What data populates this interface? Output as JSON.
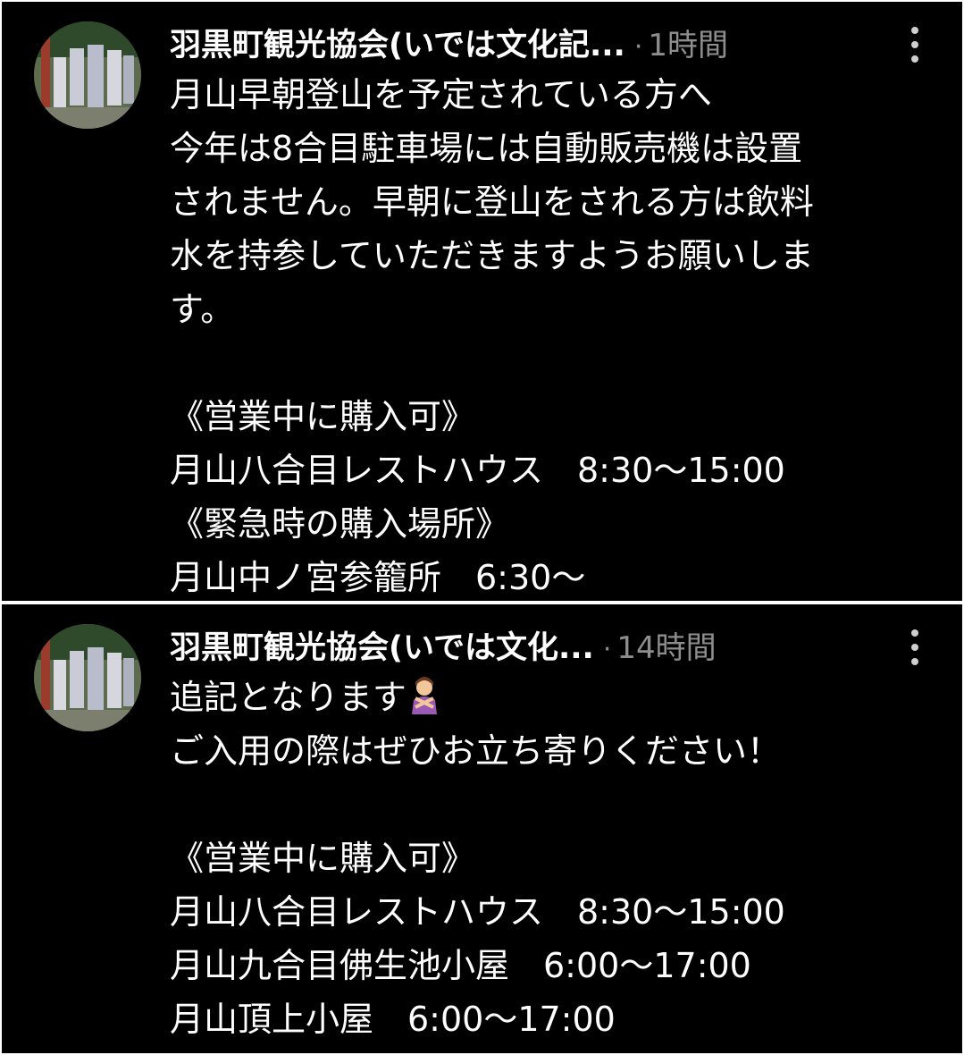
{
  "posts": [
    {
      "author": "羽黒町観光協会(いでは文化記...",
      "time": "1時間",
      "lines": [
        "月山早朝登山を予定されている方へ",
        "今年は8合目駐車場には自動販売機は設置",
        "されません。早朝に登山をされる方は飲料",
        "水を持参していただきますようお願いしま",
        "す。",
        "",
        "《営業中に購入可》",
        "月山八合目レストハウス　8:30〜15:00",
        "《緊急時の購入場所》",
        "月山中ノ宮参籠所　6:30〜"
      ]
    },
    {
      "author": "羽黒町観光協会(いでは文化...",
      "time": "14時間",
      "first_line": "追記となります",
      "emoji": "person-gesturing-no-emoji",
      "lines": [
        "ご入用の際はぜひお立ち寄りください！",
        "",
        "《営業中に購入可》",
        "月山八合目レストハウス　8:30〜15:00",
        "月山九合目佛生池小屋　6:00〜17:00",
        "月山頂上小屋　6:00〜17:00"
      ]
    }
  ],
  "icons": {
    "avatar": "avatar-image",
    "more": "more-vertical-icon"
  },
  "colors": {
    "background": "#000000",
    "text": "#ffffff",
    "meta": "#8e8e8e"
  }
}
